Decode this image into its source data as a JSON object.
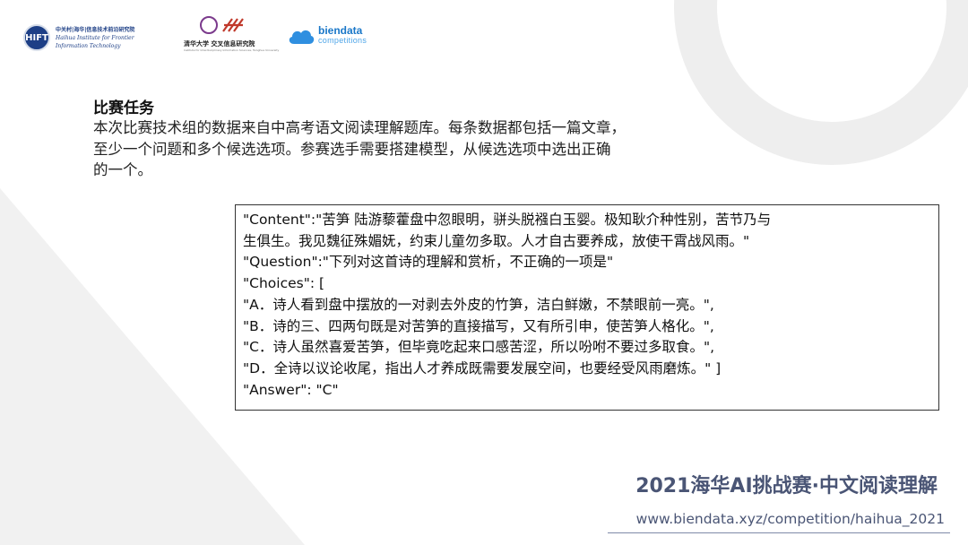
{
  "logos": {
    "haihua": {
      "seal_text": "HIFT",
      "cn": "中关村|海华|信息技术前沿研究院",
      "en1": "Haihua Institute for Frontier",
      "en2": "Information Technology"
    },
    "tsinghua": {
      "cn": "清华大学 交叉信息研究院",
      "sub": "Institute for Interdisciplinary Information Sciences, Tsinghua University"
    },
    "biendata": {
      "name": "biendata",
      "tag": "competitions"
    }
  },
  "section": {
    "title": "比赛任务",
    "intro_lines": [
      "本次比赛技术组的数据来自中高考语文阅读理解题库。每条数据都包括一篇文章，",
      "至少一个问题和多个候选选项。参赛选手需要搭建模型，从候选选项中选出正确",
      "的一个。"
    ]
  },
  "sample": {
    "lines": [
      "\"Content\":\"苦笋 陆游藜藿盘中忽眼明，骈头脱襁白玉婴。极知耿介种性别，苦节乃与",
      "生俱生。我见魏征殊媚妩，约束儿童勿多取。人才自古要养成，放使干霄战风雨。\"",
      "\"Question\":\"下列对这首诗的理解和赏析，不正确的一项是\"",
      "\"Choices\": [",
      "\"A．诗人看到盘中摆放的一对剥去外皮的竹笋，洁白鲜嫩，不禁眼前一亮。\",",
      "\"B．诗的三、四两句既是对苦笋的直接描写，又有所引申，使苦笋人格化。\",",
      "\"C．诗人虽然喜爱苦笋，但毕竟吃起来口感苦涩，所以吩咐不要过多取食。\",",
      "\"D．全诗以议论收尾，指出人才养成既需要发展空间，也要经受风雨磨炼。\" ]",
      "\"Answer\": \"C\""
    ]
  },
  "footer": {
    "title": "2021海华AI挑战赛·中文阅读理解",
    "url": "www.biendata.xyz/competition/haihua_2021"
  }
}
